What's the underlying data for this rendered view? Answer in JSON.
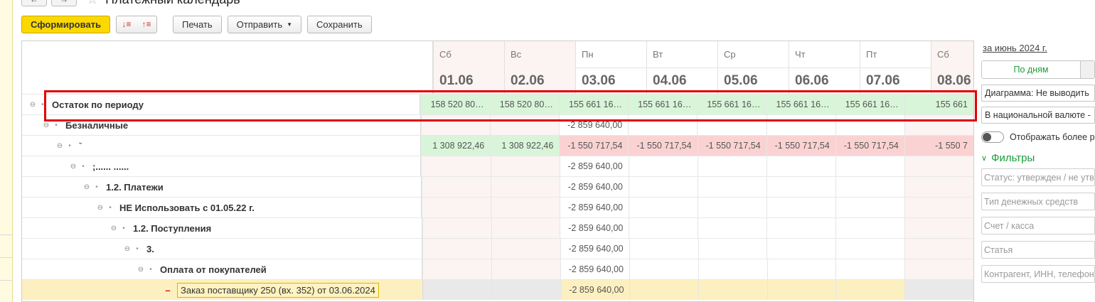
{
  "window": {
    "title": "Платежный календарь",
    "back_icon": "←",
    "forward_icon": "→",
    "star_icon": "☆"
  },
  "toolbar": {
    "generate_label": "Сформировать",
    "sort_desc_icon": "↓≡",
    "sort_asc_icon": "↑≡",
    "print_label": "Печать",
    "send_label": "Отправить",
    "send_caret": "▼",
    "save_label": "Сохранить"
  },
  "columns": [
    {
      "day": "Сб",
      "date": "01.06",
      "weekend": true
    },
    {
      "day": "Вс",
      "date": "02.06",
      "weekend": true
    },
    {
      "day": "Пн",
      "date": "03.06",
      "weekend": false
    },
    {
      "day": "Вт",
      "date": "04.06",
      "weekend": false
    },
    {
      "day": "Ср",
      "date": "05.06",
      "weekend": false
    },
    {
      "day": "Чт",
      "date": "06.06",
      "weekend": false
    },
    {
      "day": "Пт",
      "date": "07.06",
      "weekend": false
    },
    {
      "day": "Сб",
      "date": "08.06",
      "weekend": true
    }
  ],
  "rows": [
    {
      "label": "Остаток по периоду",
      "bold": true,
      "toggle": "⊖",
      "dot": "•",
      "cells": [
        [
          "158 520 80…",
          "g"
        ],
        [
          "158 520 80…",
          "g"
        ],
        [
          "155 661 16…",
          "g"
        ],
        [
          "155 661 16…",
          "g"
        ],
        [
          "155 661 16…",
          "g"
        ],
        [
          "155 661 16…",
          "g"
        ],
        [
          "155 661 16…",
          "g"
        ],
        [
          "155 661",
          "g"
        ]
      ]
    },
    {
      "label": "Безналичные",
      "bold": true,
      "toggle": "⊖",
      "dot": "•",
      "cells": [
        [
          "",
          "w"
        ],
        [
          "",
          "w"
        ],
        [
          "-2 859 640,00",
          ""
        ],
        [
          "",
          ""
        ],
        [
          "",
          ""
        ],
        [
          "",
          ""
        ],
        [
          "",
          ""
        ],
        [
          "",
          "w"
        ]
      ]
    },
    {
      "label": "ˇ",
      "bold": false,
      "toggle": "⊖",
      "dot": "•",
      "cells": [
        [
          "1 308 922,46",
          "g"
        ],
        [
          "1 308 922,46",
          "g"
        ],
        [
          "-1 550 717,54",
          "r"
        ],
        [
          "-1 550 717,54",
          "r"
        ],
        [
          "-1 550 717,54",
          "r"
        ],
        [
          "-1 550 717,54",
          "r"
        ],
        [
          "-1 550 717,54",
          "r"
        ],
        [
          "-1 550 7",
          "r"
        ]
      ]
    },
    {
      "label": ";......  ......",
      "bold": true,
      "toggle": "⊖",
      "dot": "•",
      "cells": [
        [
          "",
          "w"
        ],
        [
          "",
          "w"
        ],
        [
          "-2 859 640,00",
          ""
        ],
        [
          "",
          ""
        ],
        [
          "",
          ""
        ],
        [
          "",
          ""
        ],
        [
          "",
          ""
        ],
        [
          "",
          "w"
        ]
      ]
    },
    {
      "label": "1.2. Платежи",
      "bold": true,
      "toggle": "⊖",
      "dot": "•",
      "cells": [
        [
          "",
          "w"
        ],
        [
          "",
          "w"
        ],
        [
          "-2 859 640,00",
          ""
        ],
        [
          "",
          ""
        ],
        [
          "",
          ""
        ],
        [
          "",
          ""
        ],
        [
          "",
          ""
        ],
        [
          "",
          "w"
        ]
      ]
    },
    {
      "label": "НЕ Использовать с 01.05.22 г.",
      "bold": true,
      "toggle": "⊖",
      "dot": "•",
      "cells": [
        [
          "",
          "w"
        ],
        [
          "",
          "w"
        ],
        [
          "-2 859 640,00",
          ""
        ],
        [
          "",
          ""
        ],
        [
          "",
          ""
        ],
        [
          "",
          ""
        ],
        [
          "",
          ""
        ],
        [
          "",
          "w"
        ]
      ]
    },
    {
      "label": "1.2. Поступления",
      "bold": true,
      "toggle": "⊖",
      "dot": "•",
      "cells": [
        [
          "",
          "w"
        ],
        [
          "",
          "w"
        ],
        [
          "-2 859 640,00",
          ""
        ],
        [
          "",
          ""
        ],
        [
          "",
          ""
        ],
        [
          "",
          ""
        ],
        [
          "",
          ""
        ],
        [
          "",
          "w"
        ]
      ]
    },
    {
      "label": "3.",
      "bold": true,
      "toggle": "⊖",
      "dot": "•",
      "cells": [
        [
          "",
          "w"
        ],
        [
          "",
          "w"
        ],
        [
          "-2 859 640,00",
          ""
        ],
        [
          "",
          ""
        ],
        [
          "",
          ""
        ],
        [
          "",
          ""
        ],
        [
          "",
          ""
        ],
        [
          "",
          "w"
        ]
      ]
    },
    {
      "label": "Оплата от покупателей",
      "bold": true,
      "toggle": "⊖",
      "dot": "•",
      "cells": [
        [
          "",
          "w"
        ],
        [
          "",
          "w"
        ],
        [
          "-2 859 640,00",
          ""
        ],
        [
          "",
          ""
        ],
        [
          "",
          ""
        ],
        [
          "",
          ""
        ],
        [
          "",
          ""
        ],
        [
          "",
          "w"
        ]
      ]
    },
    {
      "label": "Заказ поставщику 250 (вх. 352) от 03.06.2024",
      "bold": false,
      "minus": "–",
      "selected": true,
      "cells": [
        [
          "",
          "gy"
        ],
        [
          "",
          "gy"
        ],
        [
          "-2 859 640,00",
          "y"
        ],
        [
          "",
          "y"
        ],
        [
          "",
          "y"
        ],
        [
          "",
          "y"
        ],
        [
          "",
          "y"
        ],
        [
          "",
          "gy"
        ]
      ]
    }
  ],
  "panel": {
    "period_link": "за июнь 2024 г.",
    "by_days_label": "По дням",
    "diagram_select": "Диаграмма: Не выводить",
    "currency_select": "В национальной валюте -",
    "show_more_label": "Отображать более р",
    "filters_label": "Фильтры",
    "filters_chevron": "∨",
    "filters": [
      "Статус: утвержден / не утв",
      "Тип денежных средств",
      "Счет / касса",
      "Статья",
      "Контрагент, ИНН, телефон"
    ]
  },
  "colors": {
    "accent_green": "#1a9d3a",
    "primary_yellow": "#fbd800",
    "positive_bg": "#d9f5d9",
    "negative_bg": "#fbd2d2",
    "highlight_red": "#e00000"
  }
}
